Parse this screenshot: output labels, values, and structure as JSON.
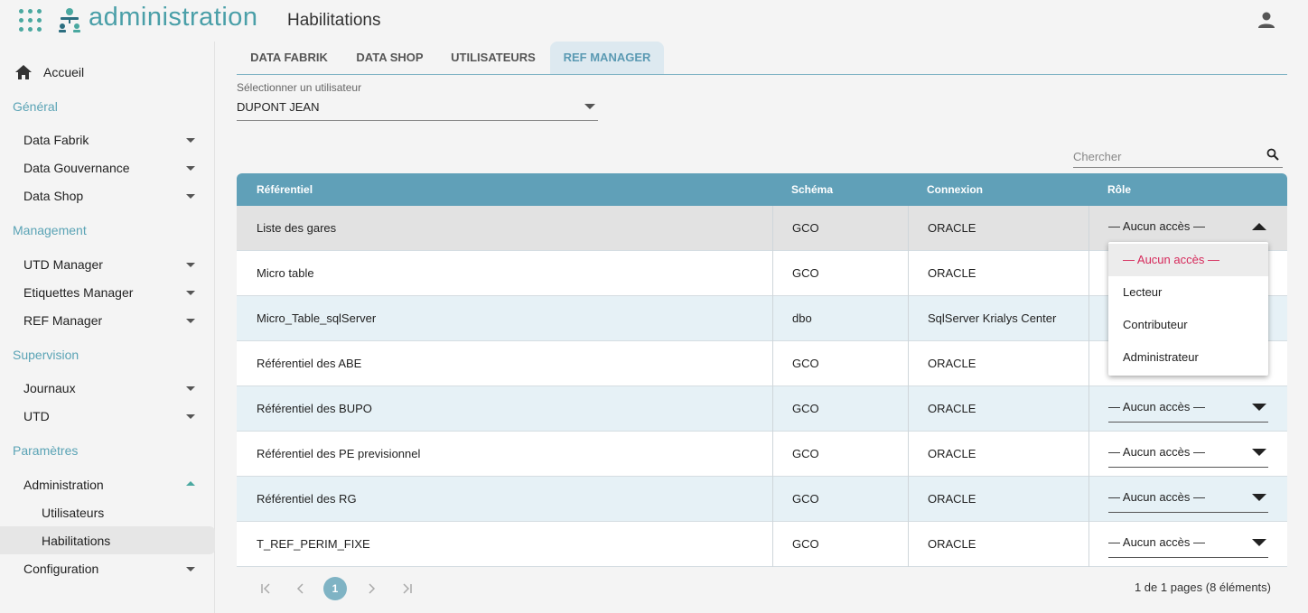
{
  "header": {
    "brand": "administration",
    "page_title": "Habilitations"
  },
  "sidebar": {
    "home": "Accueil",
    "sections": {
      "general": "Général",
      "management": "Management",
      "supervision": "Supervision",
      "parametres": "Paramètres"
    },
    "items": {
      "data_fabrik": "Data Fabrik",
      "data_gouvernance": "Data Gouvernance",
      "data_shop": "Data Shop",
      "utd_manager": "UTD Manager",
      "etiquettes_manager": "Etiquettes Manager",
      "ref_manager": "REF Manager",
      "journaux": "Journaux",
      "utd": "UTD",
      "administration": "Administration",
      "utilisateurs": "Utilisateurs",
      "habilitations": "Habilitations",
      "configuration": "Configuration"
    }
  },
  "tabs": [
    "DATA FABRIK",
    "DATA SHOP",
    "UTILISATEURS",
    "REF MANAGER"
  ],
  "active_tab": "REF MANAGER",
  "user_select": {
    "label": "Sélectionner un utilisateur",
    "value": "DUPONT JEAN"
  },
  "search": {
    "placeholder": "Chercher"
  },
  "table": {
    "columns": [
      "Référentiel",
      "Schéma",
      "Connexion",
      "Rôle"
    ],
    "rows": [
      {
        "referentiel": "Liste des gares",
        "schema": "GCO",
        "connexion": "ORACLE",
        "role": "— Aucun accès —"
      },
      {
        "referentiel": "Micro table",
        "schema": "GCO",
        "connexion": "ORACLE",
        "role": ""
      },
      {
        "referentiel": "Micro_Table_sqlServer",
        "schema": "dbo",
        "connexion": "SqlServer Krialys Center",
        "role": ""
      },
      {
        "referentiel": "Référentiel des ABE",
        "schema": "GCO",
        "connexion": "ORACLE",
        "role": ""
      },
      {
        "referentiel": "Référentiel des BUPO",
        "schema": "GCO",
        "connexion": "ORACLE",
        "role": "— Aucun accès —"
      },
      {
        "referentiel": "Référentiel des PE previsionnel",
        "schema": "GCO",
        "connexion": "ORACLE",
        "role": "— Aucun accès —"
      },
      {
        "referentiel": "Référentiel des RG",
        "schema": "GCO",
        "connexion": "ORACLE",
        "role": "— Aucun accès —"
      },
      {
        "referentiel": "T_REF_PERIM_FIXE",
        "schema": "GCO",
        "connexion": "ORACLE",
        "role": "— Aucun accès —"
      }
    ]
  },
  "role_dropdown": {
    "options": [
      "— Aucun accès —",
      "Lecteur",
      "Contributeur",
      "Administrateur"
    ],
    "selected": "— Aucun accès —"
  },
  "pager": {
    "current_page": "1",
    "info": "1 de 1 pages (8 éléments)"
  },
  "colors": {
    "accent": "#4aa8a0",
    "header_blue": "#60a0b8",
    "row_blue": "#e6f1f6",
    "selected_option": "#d6285a"
  }
}
